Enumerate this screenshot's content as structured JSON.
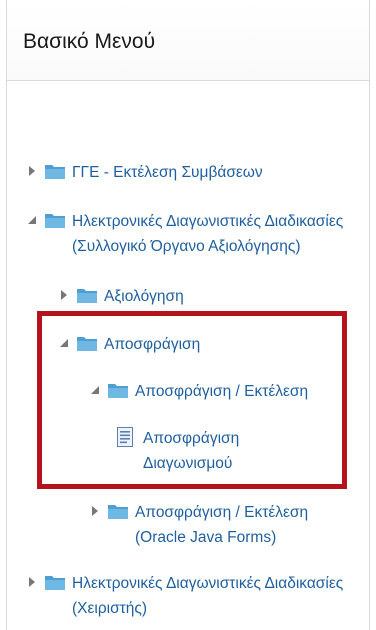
{
  "menu": {
    "title": "Βασικό Μενού",
    "items": [
      {
        "label": "ΓΓΕ - Εκτέλεση Συμβάσεων",
        "label2": ""
      },
      {
        "label": "Ηλεκτρονικές Διαγωνιστικές Διαδικασίες",
        "label2": "(Συλλογικό Όργανο Αξιολόγησης)"
      },
      {
        "label": "Αξιολόγηση",
        "label2": ""
      },
      {
        "label": "Αποσφράγιση",
        "label2": ""
      },
      {
        "label": "Αποσφράγιση / Εκτέλεση",
        "label2": ""
      },
      {
        "label": "Αποσφράγιση",
        "label2": "Διαγωνισμού"
      },
      {
        "label": "Αποσφράγιση / Εκτέλεση",
        "label2": "(Oracle Java Forms)"
      },
      {
        "label": "Ηλεκτρονικές Διαγωνιστικές Διαδικασίες",
        "label2": "(Χειριστής)"
      }
    ]
  },
  "colors": {
    "link": "#1f5f9e",
    "highlight_border": "#b5121b",
    "folder": "#5aa7d6"
  }
}
